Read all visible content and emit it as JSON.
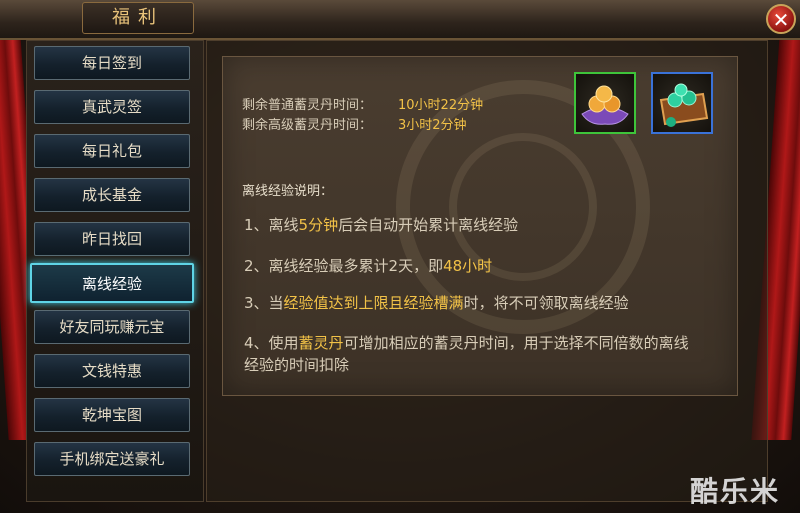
{
  "window": {
    "title": "福利",
    "close_label": "✕"
  },
  "sidebar": {
    "items": [
      {
        "label": "每日签到",
        "active": false
      },
      {
        "label": "真武灵签",
        "active": false
      },
      {
        "label": "每日礼包",
        "active": false
      },
      {
        "label": "成长基金",
        "active": false
      },
      {
        "label": "昨日找回",
        "active": false
      },
      {
        "label": "离线经验",
        "active": true
      },
      {
        "label": "好友同玩赚元宝",
        "active": false
      },
      {
        "label": "文钱特惠",
        "active": false
      },
      {
        "label": "乾坤宝图",
        "active": false
      },
      {
        "label": "手机绑定送豪礼",
        "active": false
      }
    ]
  },
  "timers": {
    "normal_label": "剩余普通蓄灵丹时间：",
    "normal_value": "10小时22分钟",
    "advanced_label": "剩余高级蓄灵丹时间：",
    "advanced_value": "3小时2分钟"
  },
  "items": {
    "normal_icon": "golden-orbs-on-purple-cushion-icon",
    "normal_border": "#3ec43a",
    "advanced_icon": "green-orbs-in-chest-icon",
    "advanced_border": "#3a72d8"
  },
  "explanation": {
    "heading": "离线经验说明：",
    "rules": [
      {
        "parts": [
          {
            "t": "1、离线",
            "h": false
          },
          {
            "t": "5分钟",
            "h": true
          },
          {
            "t": "后会自动开始累计离线经验",
            "h": false
          }
        ]
      },
      {
        "parts": [
          {
            "t": "2、离线经验最多累计2天，即",
            "h": false
          },
          {
            "t": "48小时",
            "h": true
          }
        ]
      },
      {
        "parts": [
          {
            "t": "3、当",
            "h": false
          },
          {
            "t": "经验值达到上限且经验槽满",
            "h": true
          },
          {
            "t": "时，将不可领取离线经验",
            "h": false
          }
        ]
      },
      {
        "parts": [
          {
            "t": "4、使用",
            "h": false
          },
          {
            "t": "蓄灵丹",
            "h": true
          },
          {
            "t": "可增加相应的蓄灵丹时间，用于选择不同倍数的离线经验的时间扣除",
            "h": false
          }
        ]
      }
    ]
  },
  "watermark": "酷乐米",
  "colors": {
    "highlight": "#f2c247",
    "active_tab_glow": "#5fd4e6"
  }
}
